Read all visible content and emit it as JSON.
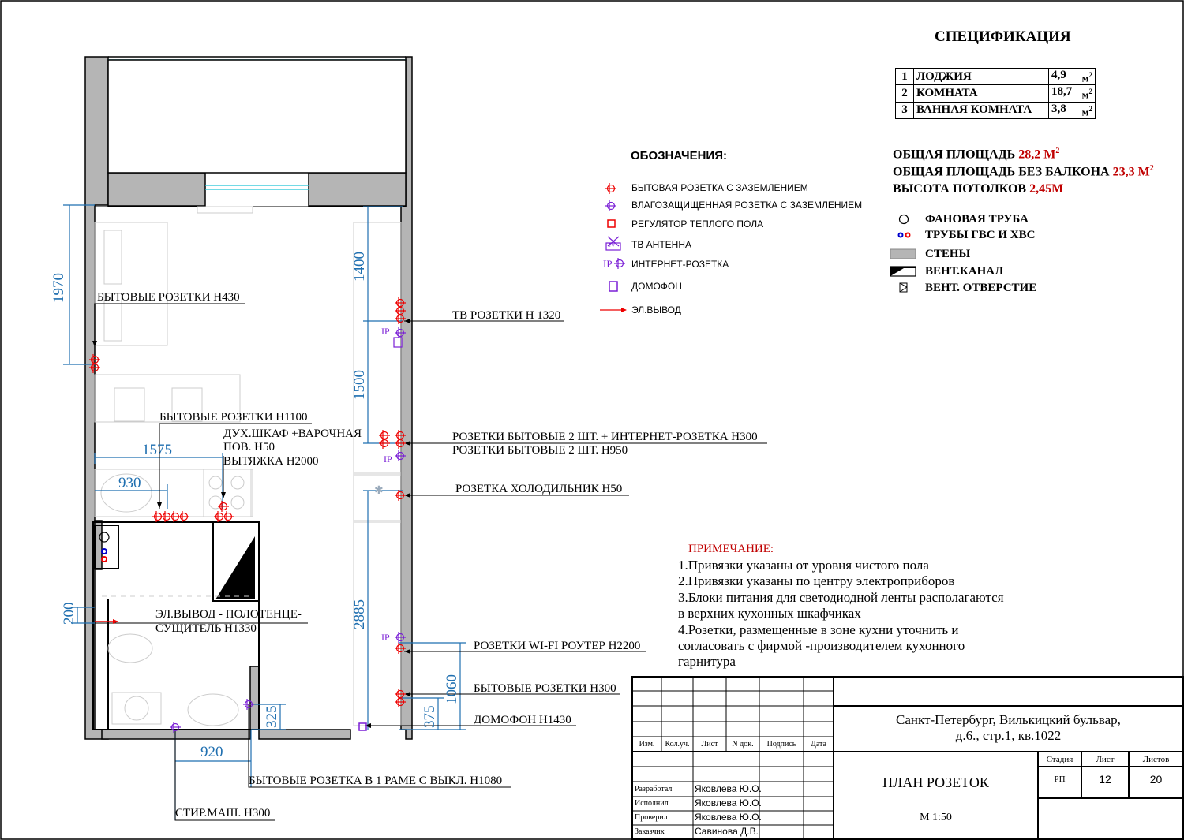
{
  "spec": {
    "title": "СПЕЦИФИКАЦИЯ",
    "rows": [
      {
        "n": "1",
        "name": "ЛОДЖИЯ",
        "area": "4,9",
        "unit": "м"
      },
      {
        "n": "2",
        "name": "КОМНАТА",
        "area": "18,7",
        "unit": "м"
      },
      {
        "n": "3",
        "name": "ВАННАЯ КОМНАТА",
        "area": "3,8",
        "unit": "м"
      }
    ],
    "sup": "2",
    "total_label": "ОБЩАЯ ПЛОЩАДЬ",
    "total_value": "28,2 М",
    "nobalcony_label": "ОБЩАЯ ПЛОЩАДЬ БЕЗ БАЛКОНА",
    "nobalcony_value": "23,3 М",
    "height_label": "ВЫСОТА ПОТОЛКОВ",
    "height_value": "2,45М"
  },
  "legend": {
    "title": "ОБОЗНАЧЕНИЯ:",
    "items": [
      "БЫТОВАЯ РОЗЕТКА С ЗАЗЕМЛЕНИЕМ",
      "ВЛАГОЗАЩИЩЕННАЯ РОЗЕТКА С ЗАЗЕМЛЕНИЕМ",
      "РЕГУЛЯТОР ТЕПЛОГО ПОЛА",
      "ТВ АНТЕННА",
      "ИНТЕРНЕТ-РОЗЕТКА",
      "ДОМОФОН",
      "ЭЛ.ВЫВОД"
    ],
    "ip": "IP",
    "tv": "TV"
  },
  "legend2": {
    "items": [
      "ФАНОВАЯ ТРУБА",
      "ТРУБЫ ГВС И ХВС",
      "СТЕНЫ",
      "ВЕНТ.КАНАЛ",
      "ВЕНТ. ОТВЕРСТИЕ"
    ]
  },
  "notes": {
    "title": "ПРИМЕЧАНИЕ:",
    "lines": [
      "1.Привязки указаны от уровня чистого пола",
      "2.Привязки указаны по центру электроприборов",
      "3.Блоки питания для светодиодной ленты располагаются",
      "в верхних кухонных шкафчиках",
      "4.Розетки, размещенные в зоне кухни уточнить и",
      "согласовать с фирмой -производителем кухонного",
      "гарнитура"
    ]
  },
  "labels": {
    "l1": "БЫТОВЫЕ РОЗЕТКИ Н430",
    "l2": "ТВ РОЗЕТКИ Н 1320",
    "l3": "БЫТОВЫЕ РОЗЕТКИ Н1100",
    "l4a": "ДУХ.ШКАФ +ВАРОЧНАЯ",
    "l4b": "ПОВ. Н50",
    "l4c": "ВЫТЯЖКА Н2000",
    "l5a": "РОЗЕТКИ БЫТОВЫЕ 2 ШТ. + ИНТЕРНЕТ-РОЗЕТКА Н300",
    "l5b": "РОЗЕТКИ БЫТОВЫЕ 2 ШТ. Н950",
    "l6": "РОЗЕТКА ХОЛОДИЛЬНИК Н50",
    "l7a": "ЭЛ.ВЫВОД - ПОЛОТЕНЦЕ-",
    "l7b": "СУЩИТЕЛЬ Н1330",
    "l8": "РОЗЕТКИ WI-FI РОУТЕР Н2200",
    "l9": "БЫТОВЫЕ РОЗЕТКИ Н300",
    "l10": "ДОМОФОН Н1430",
    "l11": "БЫТОВЫЕ РОЗЕТКА В 1 РАМЕ С ВЫКЛ. Н1080",
    "l12": "СТИР.МАШ. Н300"
  },
  "dims": {
    "d1970": "1970",
    "d1400": "1400",
    "d1500": "1500",
    "d2885": "2885",
    "d1060": "1060",
    "d375": "375",
    "d325": "325",
    "d200": "200",
    "d1575": "1575",
    "d930": "930",
    "d920": "920"
  },
  "plan_ip": [
    "IP",
    "IP",
    "IP",
    "IP"
  ],
  "titleblock": {
    "address_1": "Санкт-Петербург, Вилькицкий бульвар,",
    "address_2": "д.6., стр.1, кв.1022",
    "headers": [
      "Изм.",
      "Кол.уч.",
      "Лист",
      "N док.",
      "Подпись",
      "Дата"
    ],
    "sheet_title": "ПЛАН РОЗЕТОК",
    "scale": "М 1:50",
    "stage_h": "Стадия",
    "sheet_h": "Лист",
    "sheets_h": "Листов",
    "stage": "РП",
    "sheet": "12",
    "sheets": "20",
    "roles": [
      {
        "role": "Разработал",
        "name": "Яковлева Ю.О."
      },
      {
        "role": "Исполнил",
        "name": "Яковлева Ю.О."
      },
      {
        "role": "Проверил",
        "name": "Яковлева Ю.О."
      },
      {
        "role": "Заказчик",
        "name": "Савинова Д.В."
      }
    ]
  }
}
